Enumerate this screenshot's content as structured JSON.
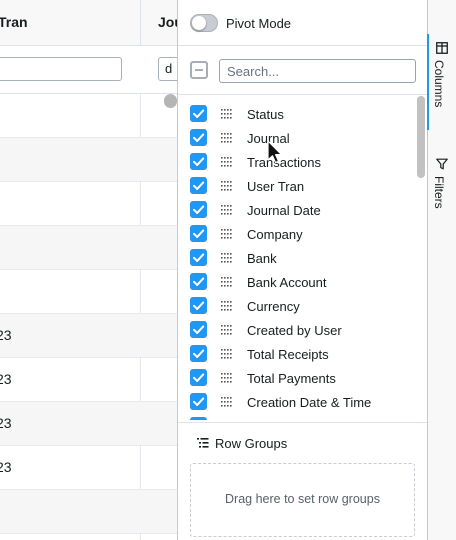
{
  "grid": {
    "headers": [
      {
        "label": "Tran"
      },
      {
        "label": "Jou"
      }
    ],
    "filters": [
      {
        "value": ""
      },
      {
        "value": "d"
      }
    ],
    "rows": [
      {
        "cell": ""
      },
      {
        "cell": ""
      },
      {
        "cell": ""
      },
      {
        "cell": ""
      },
      {
        "cell": ""
      },
      {
        "cell": "23"
      },
      {
        "cell": "23"
      },
      {
        "cell": "23"
      },
      {
        "cell": "23"
      },
      {
        "cell": ""
      }
    ]
  },
  "tool_panel": {
    "pivot_mode": {
      "label": "Pivot Mode",
      "enabled": false
    },
    "search": {
      "placeholder": "Search...",
      "value": ""
    },
    "columns": [
      {
        "label": "Status",
        "checked": true
      },
      {
        "label": "Journal",
        "checked": true
      },
      {
        "label": "Transactions",
        "checked": true
      },
      {
        "label": "User Tran",
        "checked": true
      },
      {
        "label": "Journal Date",
        "checked": true
      },
      {
        "label": "Company",
        "checked": true
      },
      {
        "label": "Bank",
        "checked": true
      },
      {
        "label": "Bank Account",
        "checked": true
      },
      {
        "label": "Currency",
        "checked": true
      },
      {
        "label": "Created by User",
        "checked": true
      },
      {
        "label": "Total Receipts",
        "checked": true
      },
      {
        "label": "Total Payments",
        "checked": true
      },
      {
        "label": "Creation Date & Time",
        "checked": true
      },
      {
        "label": "",
        "checked": true
      }
    ],
    "row_groups": {
      "label": "Row Groups",
      "drop_hint": "Drag here to set row groups"
    }
  },
  "sidebar": {
    "tabs": [
      {
        "label": "Columns",
        "icon": "columns-icon",
        "active": true
      },
      {
        "label": "Filters",
        "icon": "filter-icon",
        "active": false
      }
    ]
  },
  "colors": {
    "accent": "#2196f3",
    "border": "#c4c9d1",
    "header_bg": "#f8f8f8"
  }
}
